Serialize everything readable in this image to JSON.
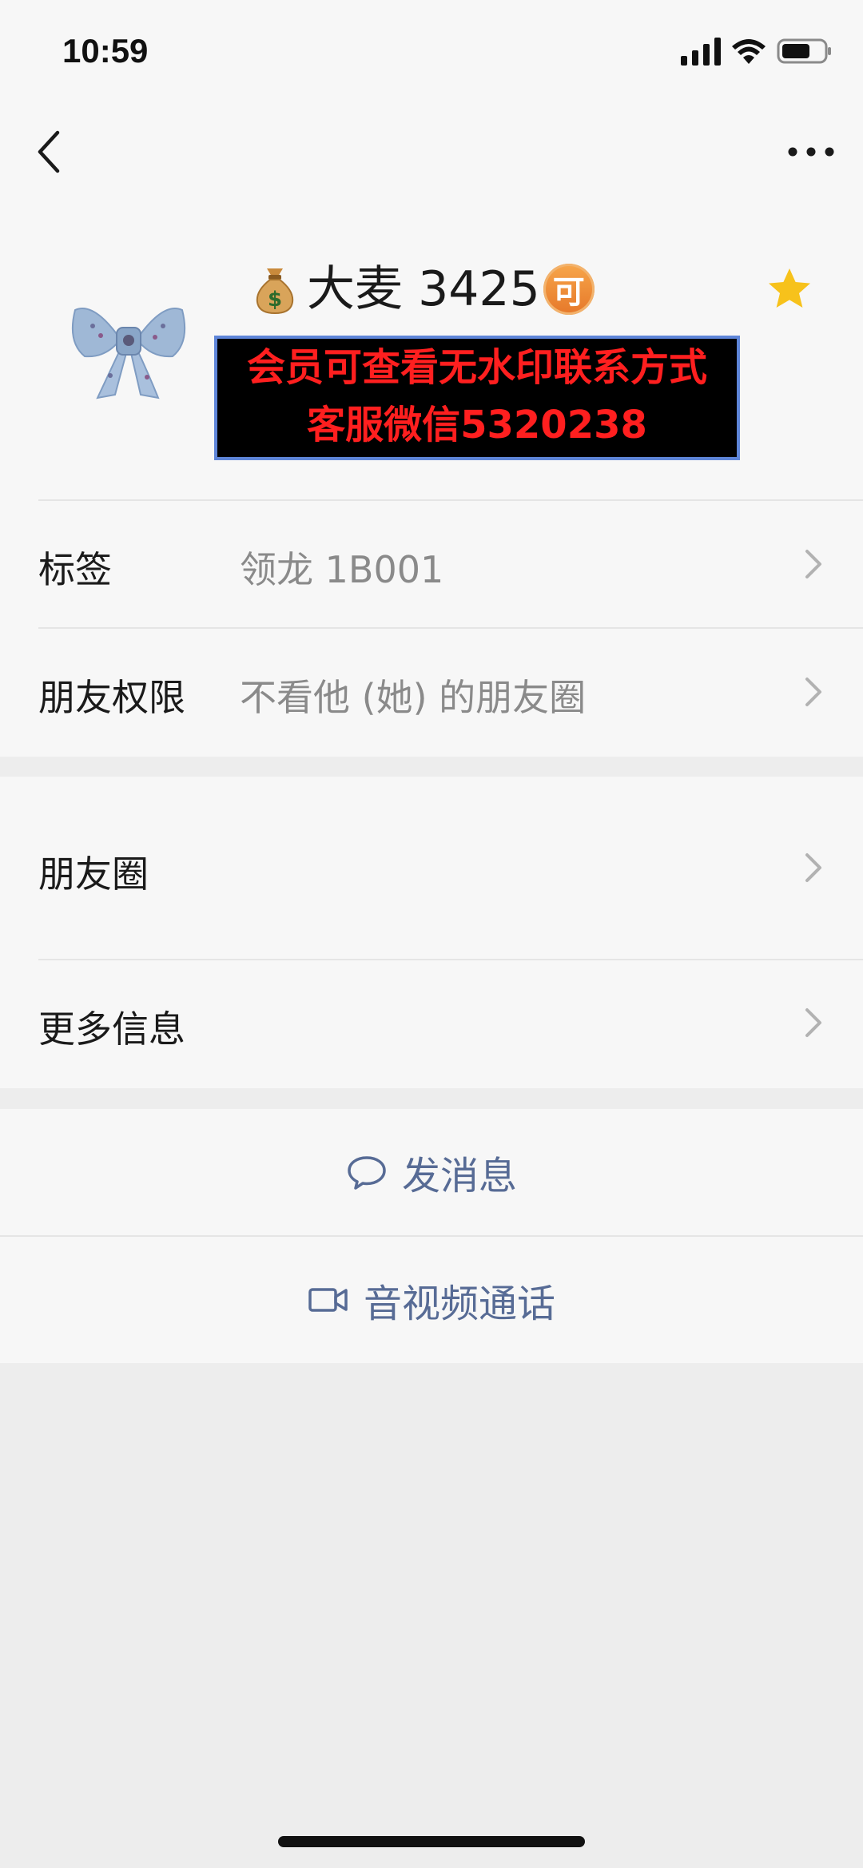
{
  "status_bar": {
    "time": "10:59"
  },
  "profile": {
    "nickname": "大麦 3425",
    "badge": "可",
    "watermark_line1": "会员可查看无水印联系方式",
    "watermark_line2": "客服微信5320238"
  },
  "info_group": [
    {
      "label": "标签",
      "value": "领龙 1B001"
    },
    {
      "label": "朋友权限",
      "value": "不看他 (她) 的朋友圈"
    }
  ],
  "moments_group": [
    {
      "label": "朋友圈"
    },
    {
      "label": "更多信息"
    }
  ],
  "actions": {
    "message_label": "发消息",
    "call_label": "音视频通话"
  },
  "colors": {
    "link_blue": "#576b95",
    "star_yellow": "#f7c21b",
    "watermark_red": "#ff1f1f"
  }
}
